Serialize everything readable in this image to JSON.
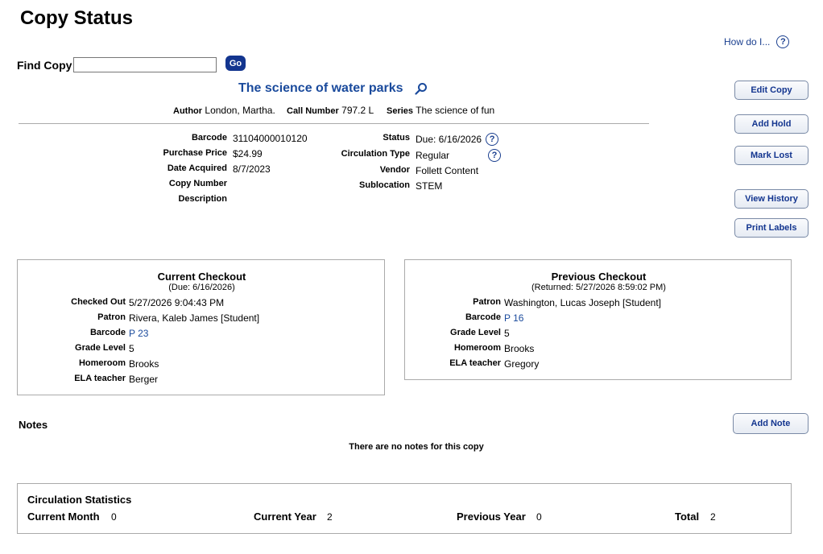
{
  "page": {
    "title": "Copy Status",
    "help_link": "How do I...",
    "help_icon": "?"
  },
  "find": {
    "label": "Find Copy",
    "value": "",
    "go_label": "Go"
  },
  "book": {
    "title": "The science of water parks",
    "author_label": "Author",
    "author": "London, Martha.",
    "call_label": "Call Number",
    "call_number": "797.2 L",
    "series_label": "Series",
    "series": "The science of fun"
  },
  "details_left": [
    {
      "label": "Barcode",
      "value": "31104000010120"
    },
    {
      "label": "Purchase Price",
      "value": "$24.99"
    },
    {
      "label": "Date Acquired",
      "value": "8/7/2023"
    },
    {
      "label": "Copy Number",
      "value": ""
    },
    {
      "label": "Description",
      "value": ""
    }
  ],
  "details_right": [
    {
      "label": "Status",
      "value": "Due: 6/16/2026"
    },
    {
      "label": "Circulation Type",
      "value": "Regular"
    },
    {
      "label": "Vendor",
      "value": "Follett Content"
    },
    {
      "label": "Sublocation",
      "value": "STEM"
    }
  ],
  "actions": {
    "edit_copy": "Edit Copy",
    "add_hold": "Add Hold",
    "mark_lost": "Mark Lost",
    "view_history": "View History",
    "print_labels": "Print Labels"
  },
  "current_checkout": {
    "title": "Current Checkout",
    "subtitle": "(Due: 6/16/2026)",
    "rows": [
      {
        "label": "Checked Out",
        "value": "5/27/2026 9:04:43 PM"
      },
      {
        "label": "Patron",
        "value": "Rivera, Kaleb James [Student]"
      },
      {
        "label": "Barcode",
        "value": "P 23"
      },
      {
        "label": "Grade Level",
        "value": "5"
      },
      {
        "label": "Homeroom",
        "value": "Brooks"
      },
      {
        "label": "ELA teacher",
        "value": "Berger"
      }
    ]
  },
  "previous_checkout": {
    "title": "Previous Checkout",
    "subtitle": "(Returned: 5/27/2026 8:59:02 PM)",
    "rows": [
      {
        "label": "Patron",
        "value": "Washington, Lucas Joseph [Student]"
      },
      {
        "label": "Barcode",
        "value": "P 16"
      },
      {
        "label": "Grade Level",
        "value": "5"
      },
      {
        "label": "Homeroom",
        "value": "Brooks"
      },
      {
        "label": "ELA teacher",
        "value": "Gregory"
      }
    ]
  },
  "notes": {
    "title": "Notes",
    "add_label": "Add Note",
    "empty_text": "There are no notes for this copy"
  },
  "stats": {
    "title": "Circulation Statistics",
    "items": [
      {
        "label": "Current Month",
        "value": "0"
      },
      {
        "label": "Current Year",
        "value": "2"
      },
      {
        "label": "Previous Year",
        "value": "0"
      },
      {
        "label": "Total",
        "value": "2"
      }
    ]
  },
  "colors": {
    "link": "#1a4a9c",
    "button_dark": "#13358f"
  }
}
